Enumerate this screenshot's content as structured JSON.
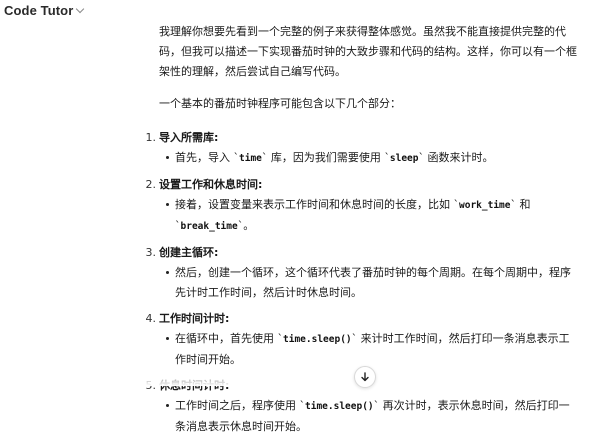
{
  "header": {
    "title": "Code Tutor"
  },
  "message": {
    "intro": "我理解你想要先看到一个完整的例子来获得整体感觉。虽然我不能直接提供完整的代码，但我可以描述一下实现番茄时钟的大致步骤和代码的结构。这样，你可以有一个框架性的理解，然后尝试自己编写代码。",
    "lead": "一个基本的番茄时钟程序可能包含以下几个部分：",
    "steps": [
      {
        "num": "1.",
        "title": "导入所需库:",
        "t1": "首先，导入 `",
        "c1": "time",
        "t2": "` 库，因为我们需要使用 `",
        "c2": "sleep",
        "t3": "` 函数来计时。"
      },
      {
        "num": "2.",
        "title": "设置工作和休息时间:",
        "t1": "接着，设置变量来表示工作时间和休息时间的长度，比如 `",
        "c1": "work_time",
        "t2": "` 和 `",
        "c2": "break_time",
        "t3": "`。"
      },
      {
        "num": "3.",
        "title": "创建主循环:",
        "t1": "然后，创建一个循环，这个循环代表了番茄时钟的每个周期。在每个周期中，程序先计时工作时间，然后计时休息时间。"
      },
      {
        "num": "4.",
        "title": "工作时间计时:",
        "t1": "在循环中，首先使用 `",
        "c1": "time.sleep()",
        "t2": "` 来计时工作时间，然后打印一条消息表示工作时间开始。"
      },
      {
        "num": "5.",
        "title": "休息时间计时:",
        "t1": "工作时间之后，程序使用 `",
        "c1": "time.sleep()",
        "t2": "` 再次计时，表示休息时间，然后打印一条消息表示休息时间开始。"
      }
    ]
  },
  "icons": {
    "chevron": "chevron-down-icon",
    "scroll_down": "arrow-down-icon"
  }
}
